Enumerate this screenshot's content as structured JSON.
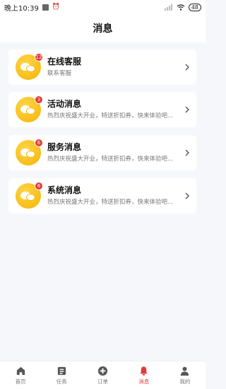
{
  "status_bar": {
    "time": "晚上10:39",
    "alarm_icon": "alarm-icon",
    "battery": "48"
  },
  "header": {
    "title": "消息"
  },
  "messages": [
    {
      "title": "在线客服",
      "subtitle": "联系客服",
      "badge": "12"
    },
    {
      "title": "活动消息",
      "subtitle": "热烈庆祝盛大开业，特送折扣券，快来体验吧...",
      "badge": "3"
    },
    {
      "title": "服务消息",
      "subtitle": "热烈庆祝盛大开业，特送折扣券，快来体验吧...",
      "badge": "6"
    },
    {
      "title": "系统消息",
      "subtitle": "热烈庆祝盛大开业，特送折扣券，快来体验吧...",
      "badge": "6"
    }
  ],
  "tabs": [
    {
      "label": "首页",
      "icon": "home-icon"
    },
    {
      "label": "任务",
      "icon": "task-icon"
    },
    {
      "label": "订单",
      "icon": "add-icon"
    },
    {
      "label": "消息",
      "icon": "bell-icon",
      "active": true
    },
    {
      "label": "我的",
      "icon": "user-icon"
    }
  ],
  "colors": {
    "accent": "#e53935",
    "avatar": "#f5b400",
    "background": "#f5f7fb"
  }
}
